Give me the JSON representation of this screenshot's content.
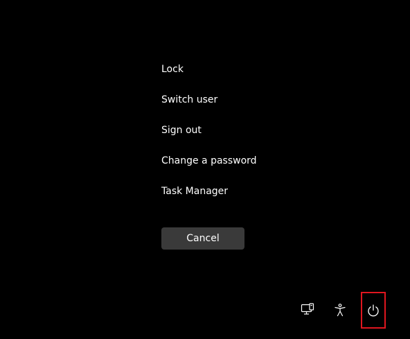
{
  "menu": {
    "items": [
      {
        "label": "Lock"
      },
      {
        "label": "Switch user"
      },
      {
        "label": "Sign out"
      },
      {
        "label": "Change a password"
      },
      {
        "label": "Task Manager"
      }
    ]
  },
  "cancel": {
    "label": "Cancel"
  },
  "tray": {
    "network_icon": "network-icon",
    "accessibility_icon": "accessibility-icon",
    "power_icon": "power-icon"
  },
  "colors": {
    "background": "#000000",
    "text": "#ffffff",
    "cancel_button": "#3a3a3a",
    "highlight_border": "#e0161f"
  }
}
